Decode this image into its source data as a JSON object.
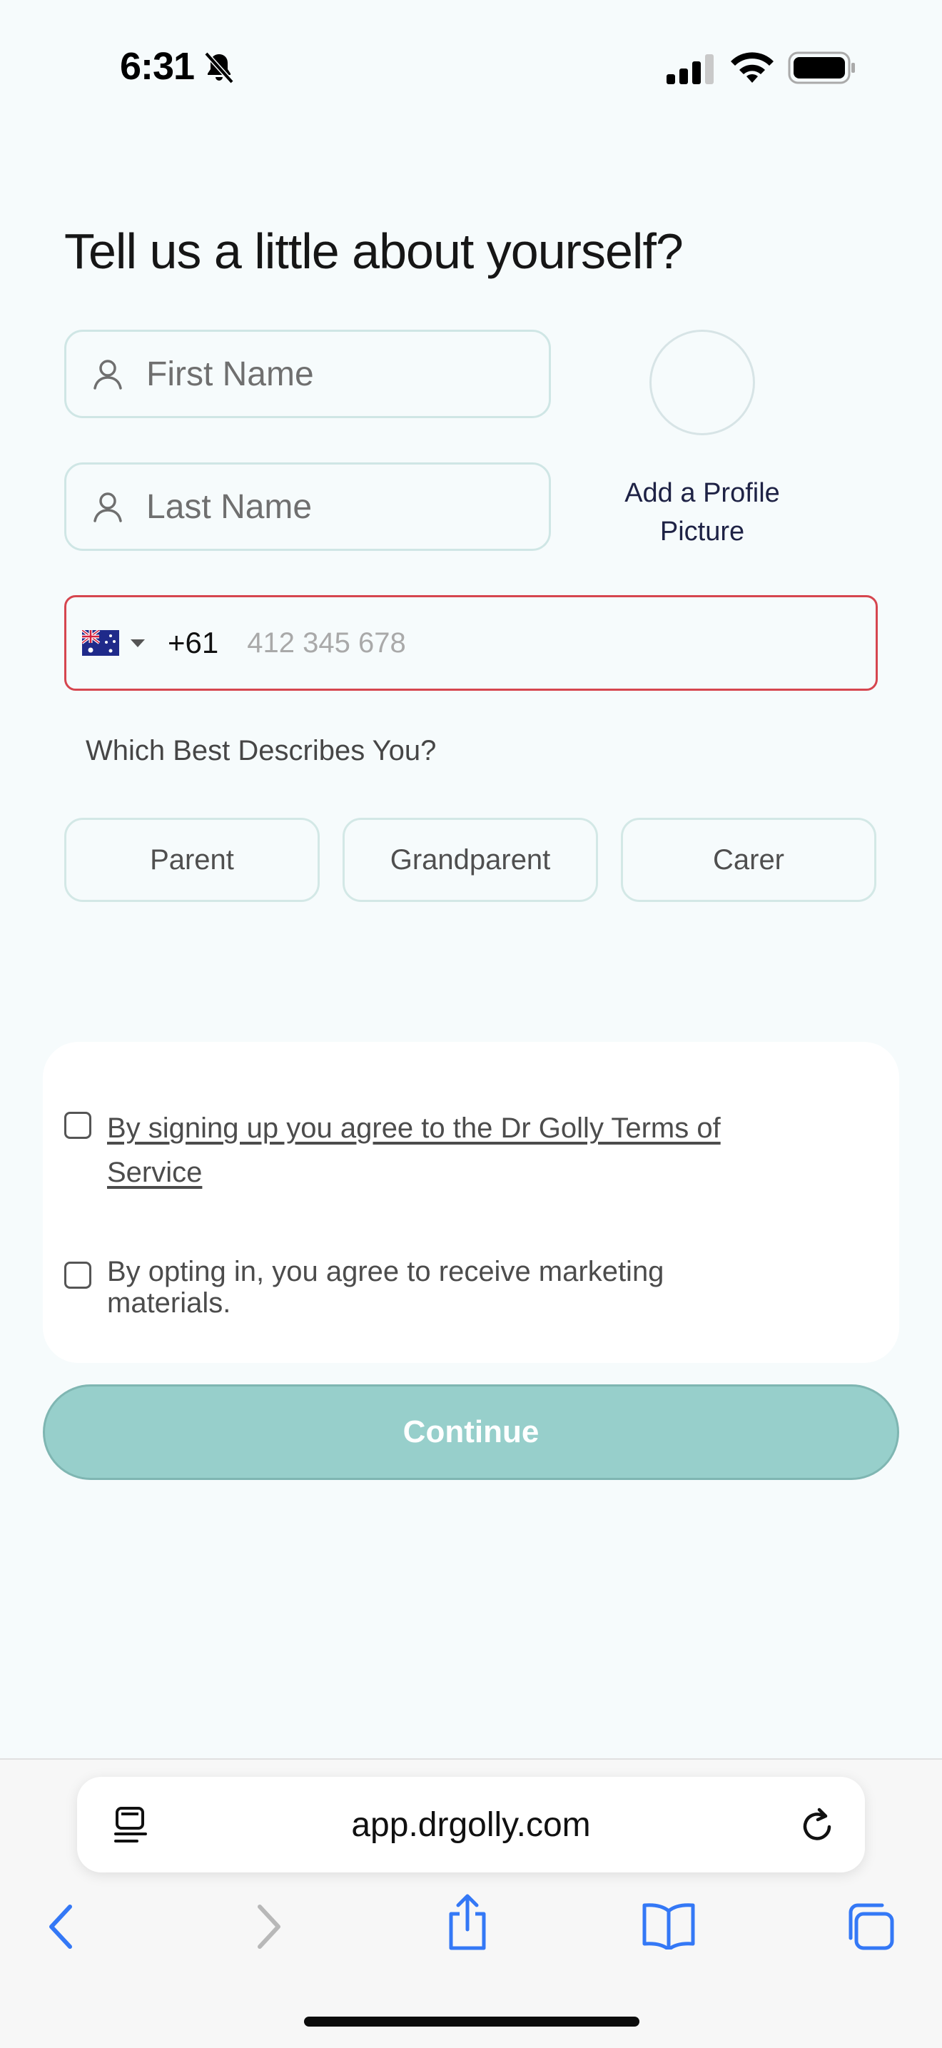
{
  "status_bar": {
    "time": "6:31",
    "icons": [
      "bell-slash-icon",
      "cellular-signal-icon",
      "wifi-icon",
      "battery-icon"
    ]
  },
  "form": {
    "title": "Tell us a little about yourself?",
    "first_name_placeholder": "First Name",
    "last_name_placeholder": "Last Name",
    "avatar_caption_line1": "Add a Profile",
    "avatar_caption_line2": "Picture",
    "phone": {
      "country": "Australia",
      "flag_icon": "australia-flag-icon",
      "dial_code": "+61",
      "placeholder": "412 345 678",
      "value": ""
    },
    "describe_label": "Which Best Describes You?",
    "options": [
      "Parent",
      "Grandparent",
      "Carer"
    ],
    "terms": {
      "line1": "By signing up you agree to the Dr Golly Terms of",
      "line2": "Service",
      "checked": false
    },
    "marketing": {
      "line1": "By opting in, you agree to receive marketing",
      "line2": "materials.",
      "checked": false
    },
    "continue_label": "Continue"
  },
  "browser": {
    "url": "app.drgolly.com",
    "toolbar_icons": [
      "back-icon",
      "forward-icon",
      "share-icon",
      "bookmarks-icon",
      "tabs-icon"
    ]
  },
  "colors": {
    "background": "#f6fbfc",
    "field_border": "#cfe6e5",
    "phone_error_border": "#d6464f",
    "continue_button": "#97cfcb",
    "ios_blue": "#3478f6",
    "ios_disabled": "#b8b8b8"
  }
}
